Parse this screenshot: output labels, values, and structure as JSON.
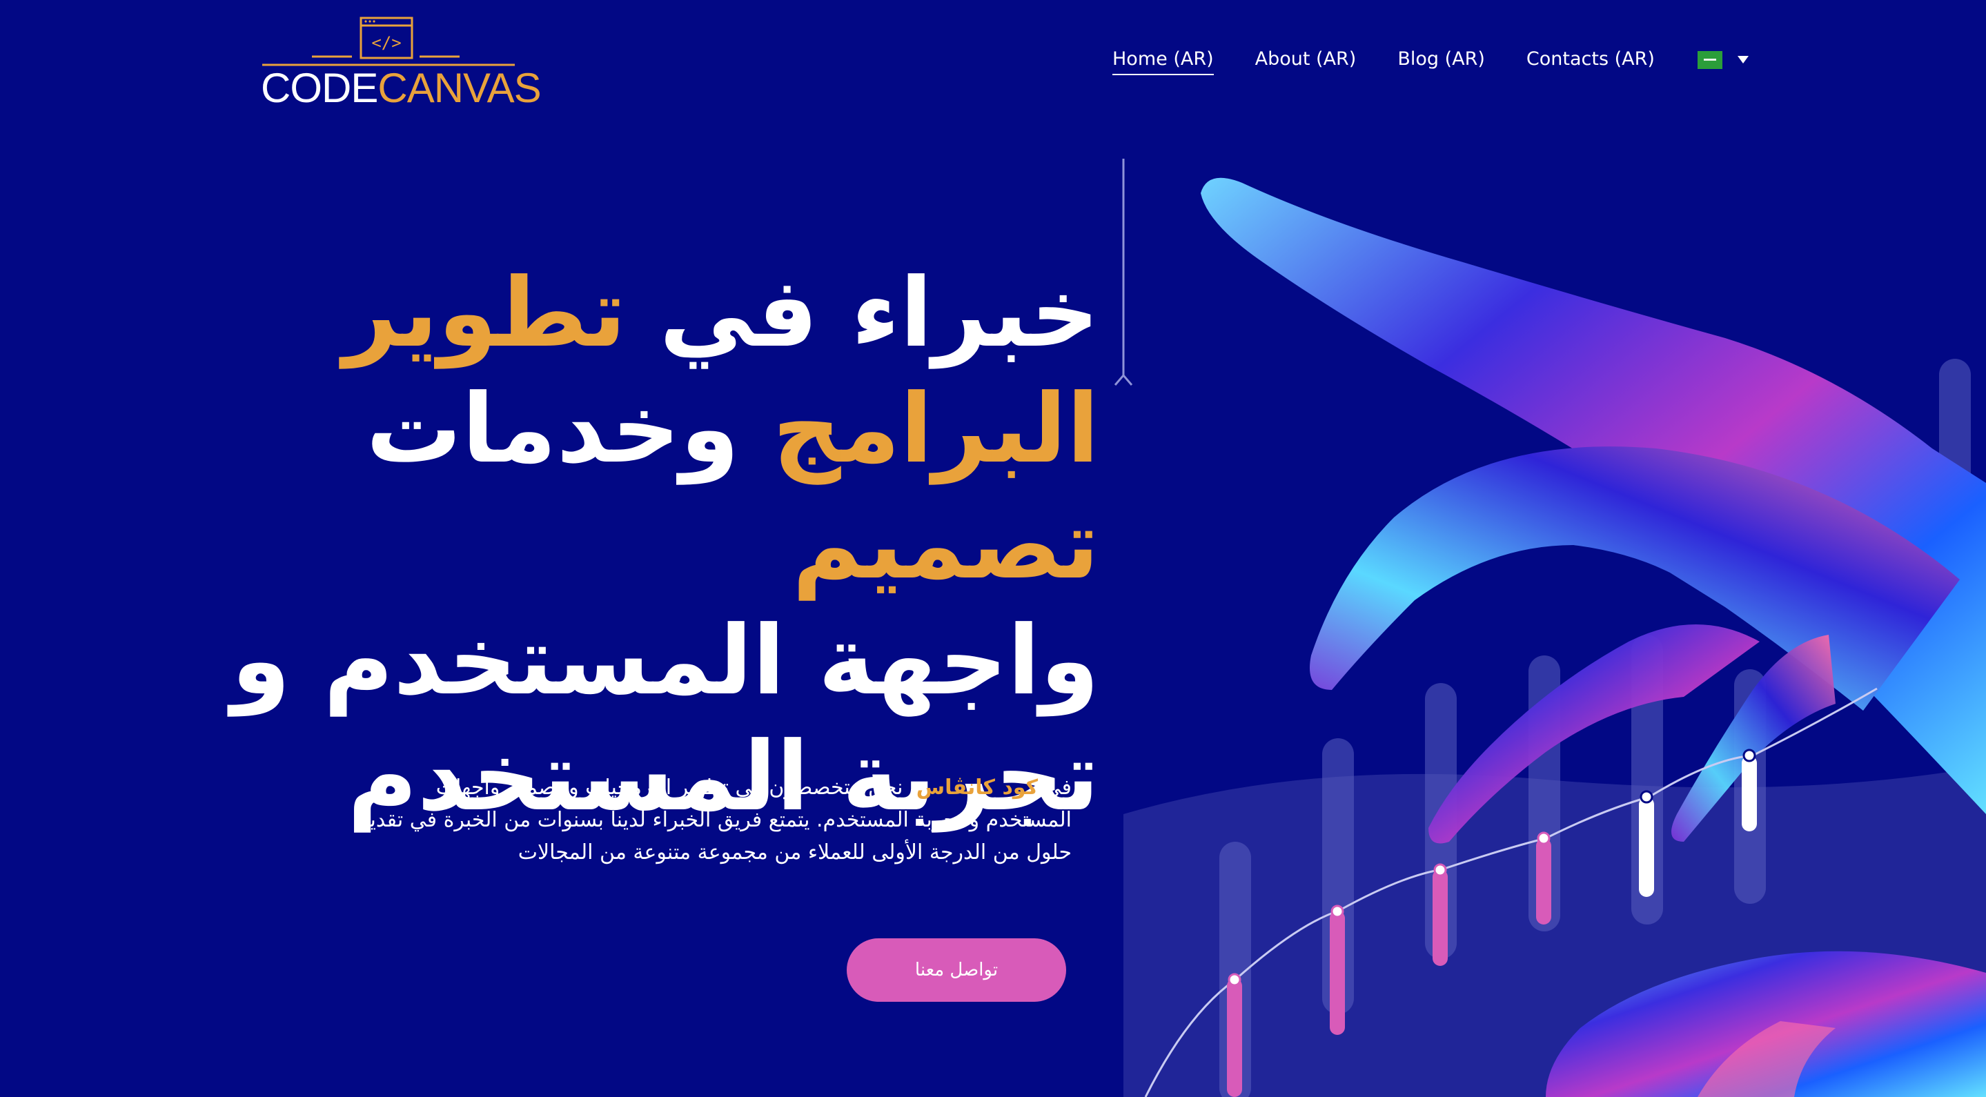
{
  "header": {
    "logo": {
      "code": "CODE",
      "canvas": "CANVAS",
      "icon_text": "</>"
    },
    "nav": [
      {
        "label": "Home (AR)",
        "active": true
      },
      {
        "label": "About (AR)",
        "active": false
      },
      {
        "label": "Blog (AR)",
        "active": false
      },
      {
        "label": "Contacts (AR)",
        "active": false
      }
    ],
    "language": {
      "flag": "saudi-arabia-flag-icon",
      "caret": "chevron-down-icon"
    }
  },
  "hero": {
    "headline": {
      "w1": "خبراء في",
      "w2": "تطوير",
      "w3": "البرامج",
      "w4": "وخدمات",
      "w5": "تصميم",
      "w6": "واجهة المستخدم و",
      "w7": "تجربة المستخدم"
    },
    "description": {
      "prefix": "في",
      "brand": "كود كانڤاس",
      "rest": "، نحن متخصصون في تطوير البرمجيات و تصميم واجهات المستخدم و تجربة المستخدم. يتمتع فريق الخبراء لدينا بسنوات من الخبرة في تقديم حلول من الدرجة الأولى للعملاء من مجموعة متنوعة من المجالات"
    },
    "cta_label": "تواصل معنا"
  },
  "colors": {
    "background": "#020885",
    "accent": "#E9A23B",
    "cta": "#D85BB9",
    "text": "#FFFFFF"
  }
}
